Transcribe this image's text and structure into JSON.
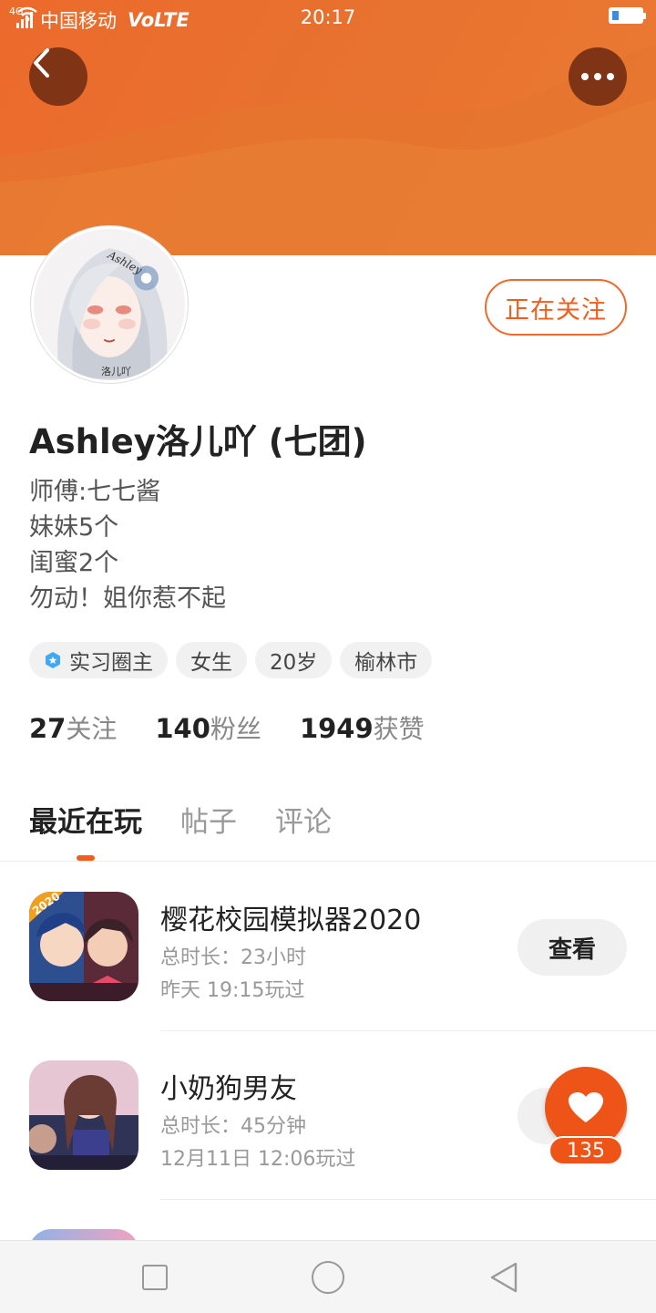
{
  "status_bar": {
    "network_tag": "4G",
    "carrier": "中国移动",
    "volte": "VoLTE",
    "time": "20:17"
  },
  "header": {
    "back_icon": "chevron-left-icon",
    "more_icon": "more-horizontal-icon",
    "banner_color": "#ec6a2c"
  },
  "profile": {
    "avatar_signature": "洛儿吖",
    "avatar_tag": "Ashley",
    "follow_label": "正在关注",
    "name": "Ashley洛儿吖 (七团)",
    "bio": [
      "师傅:七七酱",
      "妹妹5个",
      "闺蜜2个",
      "勿动！姐你惹不起"
    ],
    "tags": [
      {
        "label": "实习圈主",
        "icon": "badge-hexagon-icon"
      },
      {
        "label": "女生"
      },
      {
        "label": "20岁"
      },
      {
        "label": "榆林市"
      }
    ],
    "stats": [
      {
        "value": "27",
        "label": "关注"
      },
      {
        "value": "140",
        "label": "粉丝"
      },
      {
        "value": "1949",
        "label": "获赞"
      }
    ]
  },
  "tabs": [
    {
      "label": "最近在玩",
      "active": true
    },
    {
      "label": "帖子",
      "active": false
    },
    {
      "label": "评论",
      "active": false
    }
  ],
  "games": [
    {
      "title": "樱花校园模拟器2020",
      "duration": "总时长：23小时",
      "last_played": "昨天 19:15玩过",
      "button": "查看",
      "icon_badge": "2020"
    },
    {
      "title": "小奶狗男友",
      "duration": "总时长：45分钟",
      "last_played": "12月11日 12:06玩过",
      "button": "查看"
    }
  ],
  "fab": {
    "icon": "heart-icon",
    "count": "135",
    "color": "#ee5418"
  },
  "navbar": {
    "square_icon": "recent-apps-icon",
    "circle_icon": "home-icon",
    "triangle_icon": "back-triangle-icon"
  }
}
